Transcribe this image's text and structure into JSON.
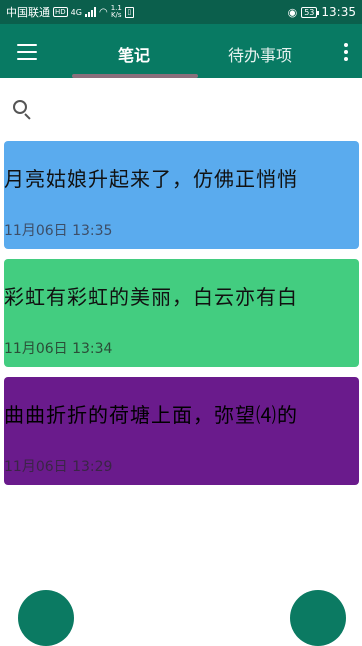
{
  "status_bar": {
    "carrier": "中国联通",
    "hd": "HD",
    "network": "4G",
    "speed_value": "1.1",
    "speed_unit": "K/s",
    "battery": "53",
    "time": "13:35"
  },
  "app_bar": {
    "tabs": [
      {
        "label": "笔记",
        "selected": true
      },
      {
        "label": "待办事项",
        "selected": false
      }
    ]
  },
  "notes": [
    {
      "text": "月亮姑娘升起来了，仿佛正悄悄",
      "time": "11月06日 13:35",
      "color": "#5aabee"
    },
    {
      "text": "彩虹有彩虹的美丽，白云亦有白",
      "time": "11月06日 13:34",
      "color": "#43cd80"
    },
    {
      "text": "曲曲折折的荷塘上面，弥望⑷的",
      "time": "11月06日 13:29",
      "color": "#6a1b8c"
    }
  ],
  "colors": {
    "status_bar": "#0b5f4c",
    "app_bar": "#087a63",
    "fab": "#0b7a62"
  },
  "icons": [
    "menu-icon",
    "more-vert-icon",
    "search-icon",
    "wifi-icon",
    "signal-icon",
    "eye-icon",
    "battery-icon",
    "sim-icon"
  ]
}
